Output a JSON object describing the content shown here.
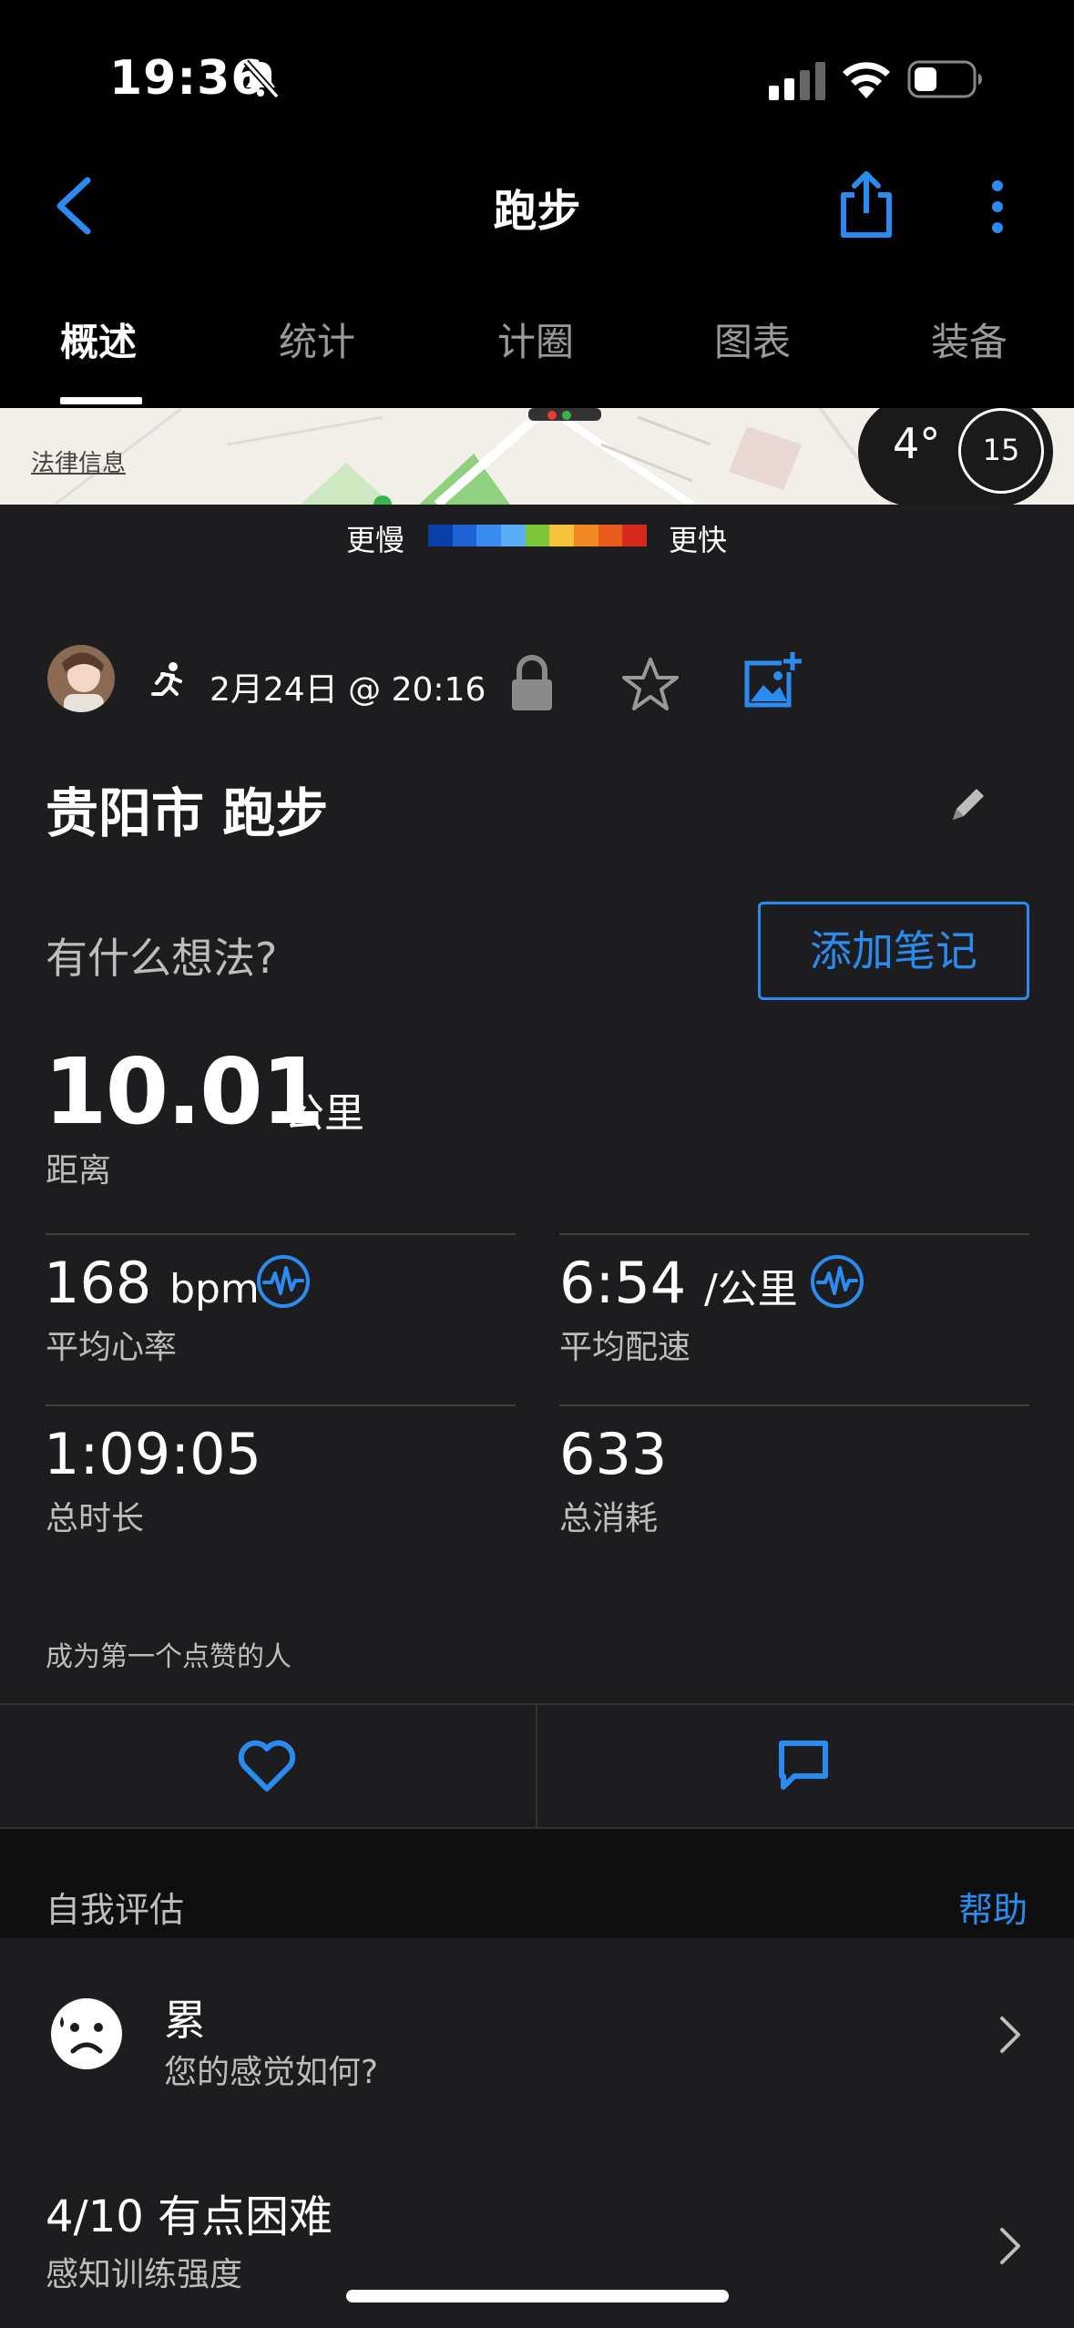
{
  "status_bar": {
    "time": "19:36"
  },
  "nav": {
    "title": "跑步"
  },
  "tabs": [
    "概述",
    "统计",
    "计圈",
    "图表",
    "装备"
  ],
  "map": {
    "legal": "法律信息",
    "temperature": "4°",
    "wind": "15"
  },
  "speed_legend": {
    "slow": "更慢",
    "fast": "更快",
    "colors": [
      "#0a3fa8",
      "#1e63d6",
      "#3b8cf0",
      "#5aaef5",
      "#7cc63a",
      "#f5c33b",
      "#f28a24",
      "#ea5a1f",
      "#d62a1c"
    ]
  },
  "activity": {
    "date": "2月24日 @ 20:16",
    "title": "贵阳市 跑步",
    "thoughts_prompt": "有什么想法?",
    "add_note": "添加笔记"
  },
  "distance": {
    "value": "10.01",
    "unit": "公里",
    "label": "距离"
  },
  "metrics": {
    "avg_hr": {
      "value": "168",
      "unit": "bpm",
      "label": "平均心率"
    },
    "avg_pace": {
      "value": "6:54",
      "unit": "/公里",
      "label": "平均配速"
    },
    "duration": {
      "value": "1:09:05",
      "label": "总时长"
    },
    "calories": {
      "value": "633",
      "label": "总消耗"
    }
  },
  "social": {
    "likes_text": "成为第一个点赞的人"
  },
  "self_eval": {
    "title": "自我评估",
    "help": "帮助",
    "feeling": {
      "title": "累",
      "subtitle": "您的感觉如何?"
    },
    "effort": {
      "title": "4/10 有点困难",
      "subtitle": "感知训练强度"
    }
  },
  "colors": {
    "accent": "#2a8cf0",
    "background": "#1d1d1f"
  }
}
